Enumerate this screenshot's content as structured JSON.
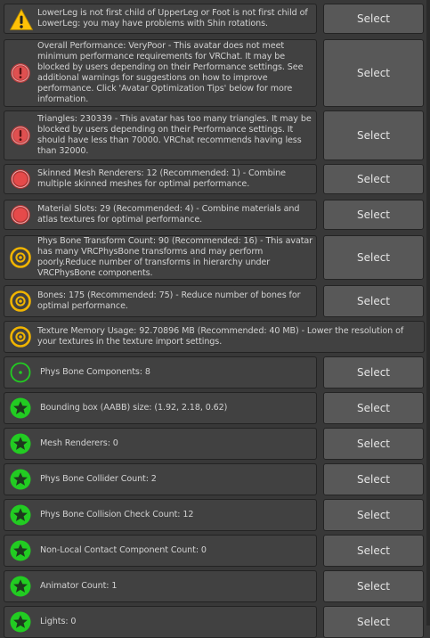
{
  "select_label": "Select",
  "colors": {
    "warning": "#ffc107",
    "error": "#e05050",
    "caution": "#f0b400",
    "good": "#22cc22"
  },
  "messages": [
    {
      "icon": "warning-triangle-icon",
      "level": "warning",
      "text": "LowerLeg is not first child of UpperLeg or Foot is not first child of LowerLeg: you may have problems with Shin rotations.",
      "has_select": true
    },
    {
      "icon": "error-exclamation-icon",
      "level": "error",
      "text": "Overall Performance: VeryPoor - This avatar does not meet minimum performance requirements for VRChat. It may be blocked by users depending on their Performance settings. See additional warnings for suggestions on how to improve performance. Click 'Avatar Optimization Tips' below for more information.",
      "has_select": true
    },
    {
      "icon": "error-exclamation-icon",
      "level": "error",
      "text": "Triangles: 230339 - This avatar has too many triangles. It may be blocked by users depending on their Performance settings. It should have less than 70000. VRChat recommends having less than 32000.",
      "has_select": true
    },
    {
      "icon": "poor-rating-icon",
      "level": "poor",
      "text": "Skinned Mesh Renderers: 12 (Recommended: 1) - Combine multiple skinned meshes for optimal performance.",
      "has_select": true
    },
    {
      "icon": "poor-rating-icon",
      "level": "poor",
      "text": "Material Slots: 29 (Recommended: 4) - Combine materials and atlas textures for optimal performance.",
      "has_select": true
    },
    {
      "icon": "medium-rating-icon",
      "level": "medium",
      "text": "Phys Bone Transform Count: 90 (Recommended: 16) - This avatar has many VRCPhysBone transforms and may perform poorly.Reduce number of transforms in hierarchy under VRCPhysBone components.",
      "has_select": true
    },
    {
      "icon": "medium-rating-icon",
      "level": "medium",
      "text": "Bones: 175 (Recommended: 75) - Reduce number of bones for optimal performance.",
      "has_select": true
    },
    {
      "icon": "medium-rating-icon",
      "level": "medium",
      "text": "Texture Memory Usage: 92.70896 MB (Recommended: 40 MB) - Lower the resolution of your textures in the texture import settings.",
      "has_select": false
    },
    {
      "icon": "good-rating-icon",
      "level": "good",
      "text": "Phys Bone Components: 8",
      "has_select": true
    },
    {
      "icon": "excellent-star-icon",
      "level": "excellent",
      "text": "Bounding box (AABB) size: (1.92, 2.18, 0.62)",
      "has_select": true
    },
    {
      "icon": "excellent-star-icon",
      "level": "excellent",
      "text": "Mesh Renderers: 0",
      "has_select": true
    },
    {
      "icon": "excellent-star-icon",
      "level": "excellent",
      "text": "Phys Bone Collider Count: 2",
      "has_select": true
    },
    {
      "icon": "excellent-star-icon",
      "level": "excellent",
      "text": "Phys Bone Collision Check Count: 12",
      "has_select": true
    },
    {
      "icon": "excellent-star-icon",
      "level": "excellent",
      "text": "Non-Local Contact Component Count: 0",
      "has_select": true
    },
    {
      "icon": "excellent-star-icon",
      "level": "excellent",
      "text": "Animator Count: 1",
      "has_select": true
    },
    {
      "icon": "excellent-star-icon",
      "level": "excellent",
      "text": "Lights: 0",
      "has_select": true
    }
  ]
}
